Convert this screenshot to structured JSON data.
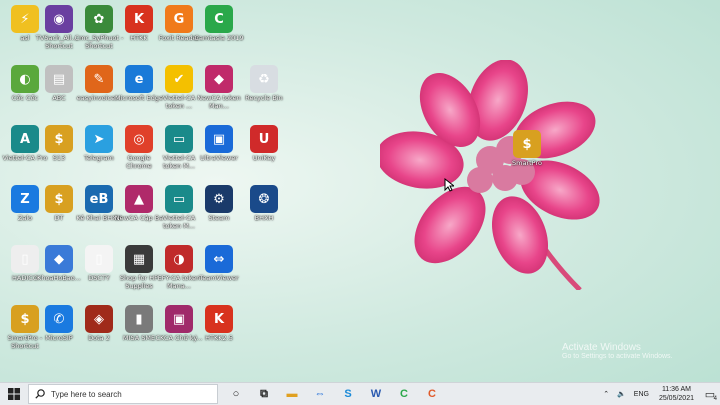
{
  "desktop": {
    "icons": [
      {
        "label": "asl",
        "color": "#f0c020",
        "glyph": "⚡"
      },
      {
        "label": "TVSach_All... - Shortcut",
        "color": "#6a3fa0",
        "glyph": "◉"
      },
      {
        "label": "Cmc_SyPhuot - Shortcut",
        "color": "#3a8a3a",
        "glyph": "✿"
      },
      {
        "label": "HTKK",
        "color": "#d8321e",
        "glyph": "K"
      },
      {
        "label": "Foxit Reader",
        "color": "#f07a1a",
        "glyph": "G"
      },
      {
        "label": "Camtasia 2019",
        "color": "#2aa84a",
        "glyph": "C"
      },
      {
        "label": "Cốc Cốc",
        "color": "#5aa83c",
        "glyph": "◐"
      },
      {
        "label": "ABC",
        "color": "#c0c0c0",
        "glyph": "▤"
      },
      {
        "label": "easyinvoice...",
        "color": "#e0661a",
        "glyph": "✎"
      },
      {
        "label": "Microsoft Edge",
        "color": "#1a7ad8",
        "glyph": "e"
      },
      {
        "label": "Viettel-CA token ...",
        "color": "#f4c000",
        "glyph": "✔"
      },
      {
        "label": "NewCA token Man...",
        "color": "#c02a6a",
        "glyph": "◆"
      },
      {
        "label": "Recycle Bin",
        "color": "#d8dde2",
        "glyph": "♻"
      },
      {
        "label": "Viettel-CA Pro",
        "color": "#1a8a8a",
        "glyph": "A"
      },
      {
        "label": "S13",
        "color": "#d8a020",
        "glyph": "$"
      },
      {
        "label": "Telegram",
        "color": "#2aa0e0",
        "glyph": "➤"
      },
      {
        "label": "Google Chrome",
        "color": "#e0402a",
        "glyph": "◎"
      },
      {
        "label": "Viettel-CA token M...",
        "color": "#1a8a8a",
        "glyph": "▭"
      },
      {
        "label": "UltraViewer",
        "color": "#1a6ad8",
        "glyph": "▣"
      },
      {
        "label": "UniKey",
        "color": "#d02a2a",
        "glyph": "U"
      },
      {
        "label": "Zalo",
        "color": "#1a7ae0",
        "glyph": "Z"
      },
      {
        "label": "DT",
        "color": "#d8a020",
        "glyph": "$"
      },
      {
        "label": "Kê Khai BHXH",
        "color": "#1a6ab0",
        "glyph": "eB"
      },
      {
        "label": "NewCA Cập Ba",
        "color": "#b02a6a",
        "glyph": "▲"
      },
      {
        "label": "Viettel-CA token M...",
        "color": "#1a8a8a",
        "glyph": "▭"
      },
      {
        "label": "Steam",
        "color": "#1a3a6a",
        "glyph": "⚙"
      },
      {
        "label": "BHXH",
        "color": "#1a4a8a",
        "glyph": "❂"
      },
      {
        "label": "HADICO",
        "color": "#eeeeee",
        "glyph": "▯"
      },
      {
        "label": "KhoaHoBao...",
        "color": "#3a7ad8",
        "glyph": "◆"
      },
      {
        "label": "DSCTY",
        "color": "#f4f4f4",
        "glyph": "▯"
      },
      {
        "label": "Shop for HP Supplies",
        "color": "#3a3a3a",
        "glyph": "▦"
      },
      {
        "label": "EFY-CA token Mana...",
        "color": "#c02a2a",
        "glyph": "◑"
      },
      {
        "label": "TeamViewer",
        "color": "#1a6ad8",
        "glyph": "⇔"
      },
      {
        "label": "SmartPro - Shortcut",
        "color": "#d8a020",
        "glyph": "$"
      },
      {
        "label": "MicroSIP",
        "color": "#1a7ae0",
        "glyph": "✆"
      },
      {
        "label": "Dota 2",
        "color": "#a02a1a",
        "glyph": "◈"
      },
      {
        "label": "MISA SME",
        "color": "#7a7a7a",
        "glyph": "▮"
      },
      {
        "label": "CKCA Chữ ký...",
        "color": "#a02a6a",
        "glyph": "▣"
      },
      {
        "label": "HTKK2.5",
        "color": "#d8321e",
        "glyph": "K"
      },
      {
        "label": "SmartPro",
        "color": "#d8a020",
        "glyph": "$"
      }
    ]
  },
  "watermark": {
    "title": "Activate Windows",
    "subtitle": "Go to Settings to activate Windows."
  },
  "taskbar": {
    "search_placeholder": "Type here to search",
    "pinned": [
      {
        "name": "cortana",
        "glyph": "○",
        "color": "#222"
      },
      {
        "name": "task-view",
        "glyph": "⧉",
        "color": "#222"
      },
      {
        "name": "file-explorer",
        "glyph": "▬",
        "color": "#e0a020"
      },
      {
        "name": "teamviewer",
        "glyph": "⇔",
        "color": "#1a6ad8"
      },
      {
        "name": "skype",
        "glyph": "S",
        "color": "#1a8ad8"
      },
      {
        "name": "word",
        "glyph": "W",
        "color": "#2a5ab0"
      },
      {
        "name": "camtasia",
        "glyph": "C",
        "color": "#2aa84a"
      },
      {
        "name": "camtasia-recorder",
        "glyph": "C",
        "color": "#e05a2a"
      }
    ],
    "tray": {
      "lang": "ENG",
      "time": "11:36 AM",
      "date": "25/05/2021",
      "notifications": "4"
    }
  }
}
